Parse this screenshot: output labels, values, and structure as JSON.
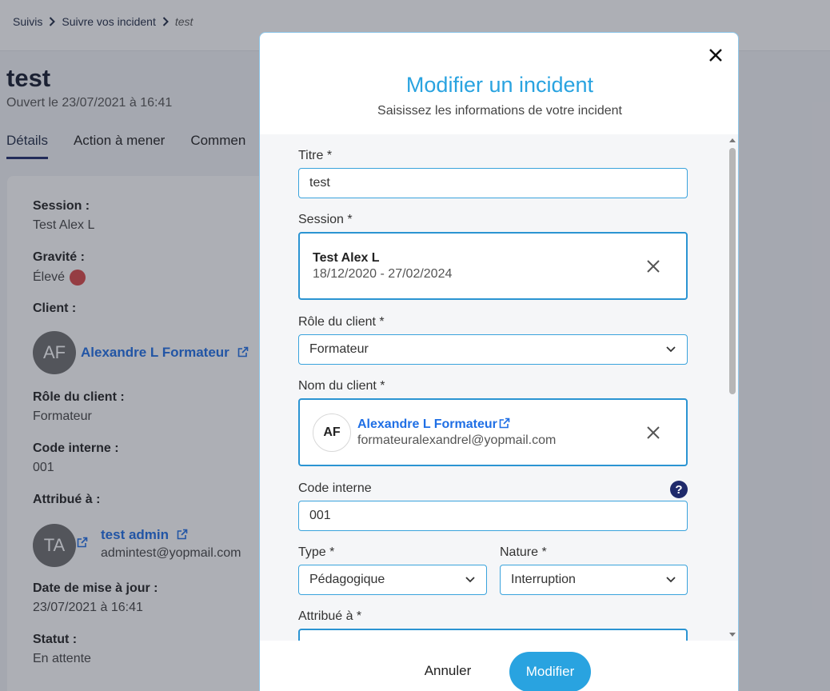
{
  "breadcrumb": {
    "items": [
      "Suivis",
      "Suivre vos incident"
    ],
    "current": "test"
  },
  "page": {
    "title": "test",
    "subtitle": "Ouvert le 23/07/2021 à 16:41",
    "tabs": [
      {
        "label": "Détails",
        "active": true
      },
      {
        "label": "Action à mener",
        "active": false
      },
      {
        "label": "Commen",
        "active": false
      }
    ]
  },
  "details": {
    "session_label": "Session :",
    "session_value": "Test Alex L",
    "gravite_label": "Gravité :",
    "gravite_value": "Élevé",
    "gravite_color": "#d84848",
    "client_label": "Client :",
    "client_initials": "AF",
    "client_name": "Alexandre L Formateur",
    "role_label": "Rôle du client :",
    "role_value": "Formateur",
    "code_label": "Code interne :",
    "code_value": "001",
    "attribue_label": "Attribué à :",
    "attribue_initials": "TA",
    "attribue_name": "test admin",
    "attribue_email": "admintest@yopmail.com",
    "maj_label": "Date de mise à jour :",
    "maj_value": "23/07/2021 à 16:41",
    "statut_label": "Statut :",
    "statut_value": "En attente"
  },
  "modal": {
    "title": "Modifier un incident",
    "subtitle": "Saisissez les informations de votre incident",
    "titre_label": "Titre *",
    "titre_value": "test",
    "session_label": "Session *",
    "session_name": "Test Alex L",
    "session_dates": "18/12/2020 - 27/02/2024",
    "role_label": "Rôle du client *",
    "role_value": "Formateur",
    "nom_label": "Nom du client *",
    "client_initials": "AF",
    "client_name": "Alexandre L Formateur",
    "client_email": "formateuralexandrel@yopmail.com",
    "code_label": "Code interne",
    "code_value": "001",
    "help_glyph": "?",
    "type_label": "Type *",
    "type_value": "Pédagogique",
    "nature_label": "Nature *",
    "nature_value": "Interruption",
    "attribue_label": "Attribué à *",
    "attribue_value": "",
    "cancel_label": "Annuler",
    "submit_label": "Modifier"
  },
  "colors": {
    "accent": "#29a3e0",
    "link": "#1f6fe5",
    "navy": "#1f2a6b"
  },
  "icons": [
    "chevron-right-icon",
    "external-link-icon",
    "close-icon",
    "clear-icon",
    "chevron-down-icon",
    "help-icon"
  ]
}
